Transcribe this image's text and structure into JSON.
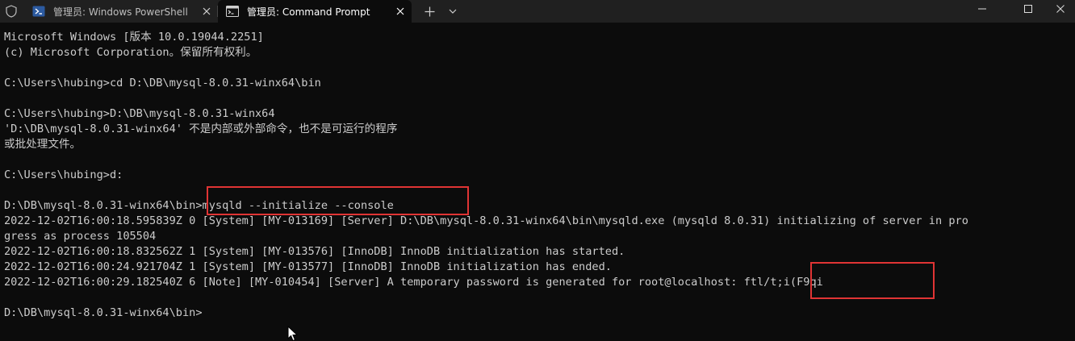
{
  "window": {
    "tabs": [
      {
        "label": "管理员: Windows PowerShell",
        "icon": "powershell-icon",
        "active": false
      },
      {
        "label": "管理员: Command Prompt",
        "icon": "cmd-icon",
        "active": true
      }
    ],
    "controls": {
      "minimize": "minimize-icon",
      "maximize": "maximize-icon",
      "close": "close-icon"
    }
  },
  "terminal": {
    "lines": [
      "Microsoft Windows [版本 10.0.19044.2251]",
      "(c) Microsoft Corporation。保留所有权利。",
      "",
      "C:\\Users\\hubing>cd D:\\DB\\mysql-8.0.31-winx64\\bin",
      "",
      "C:\\Users\\hubing>D:\\DB\\mysql-8.0.31-winx64",
      "'D:\\DB\\mysql-8.0.31-winx64' 不是内部或外部命令，也不是可运行的程序",
      "或批处理文件。",
      "",
      "C:\\Users\\hubing>d:",
      "",
      "D:\\DB\\mysql-8.0.31-winx64\\bin>mysqld --initialize --console",
      "2022-12-02T16:00:18.595839Z 0 [System] [MY-013169] [Server] D:\\DB\\mysql-8.0.31-winx64\\bin\\mysqld.exe (mysqld 8.0.31) initializing of server in pro",
      "gress as process 105504",
      "2022-12-02T16:00:18.832562Z 1 [System] [MY-013576] [InnoDB] InnoDB initialization has started.",
      "2022-12-02T16:00:24.921704Z 1 [System] [MY-013577] [InnoDB] InnoDB initialization has ended.",
      "2022-12-02T16:00:29.182540Z 6 [Note] [MY-010454] [Server] A temporary password is generated for root@localhost: ftl/t;i(F9qi",
      "",
      "D:\\DB\\mysql-8.0.31-winx64\\bin>"
    ]
  },
  "colors": {
    "terminal_bg": "#0c0c0c",
    "terminal_fg": "#cccccc",
    "titlebar_bg": "#202020",
    "highlight": "#e03434"
  }
}
